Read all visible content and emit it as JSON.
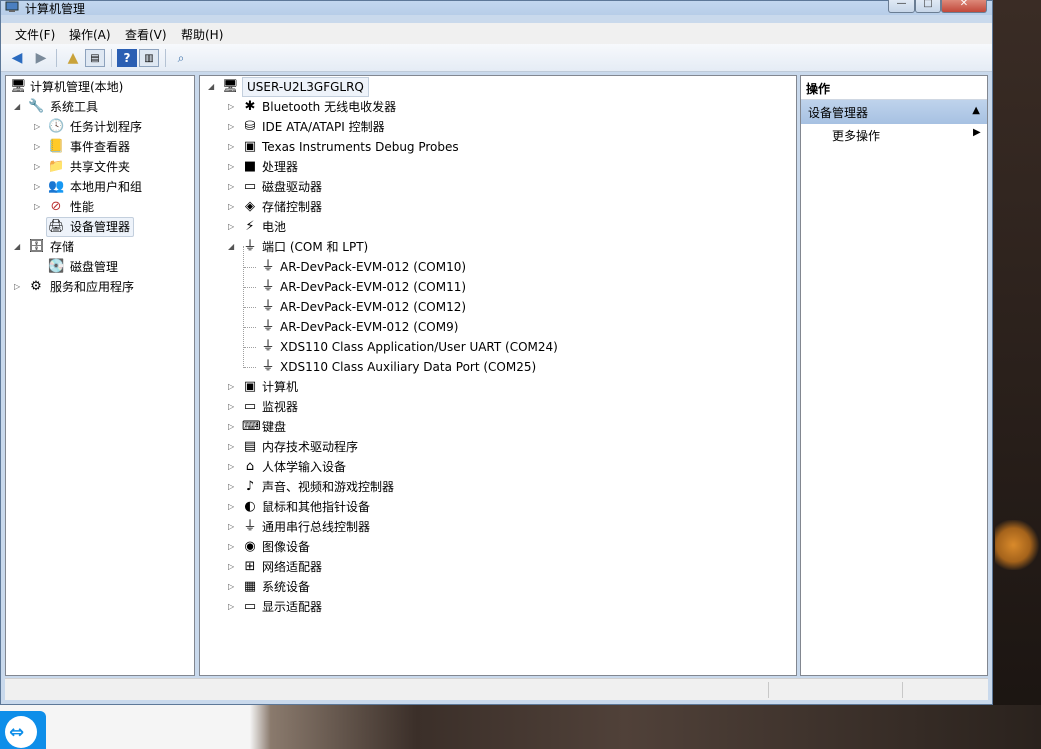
{
  "window": {
    "title": "计算机管理"
  },
  "menubar": {
    "items": [
      "文件(F)",
      "操作(A)",
      "查看(V)",
      "帮助(H)"
    ]
  },
  "left_tree": {
    "root": "计算机管理(本地)",
    "items": [
      {
        "label": "系统工具",
        "icon": "tools-icon"
      },
      {
        "label": "任务计划程序",
        "icon": "clock-icon"
      },
      {
        "label": "事件查看器",
        "icon": "event-viewer-icon"
      },
      {
        "label": "共享文件夹",
        "icon": "shared-folder-icon"
      },
      {
        "label": "本地用户和组",
        "icon": "users-icon"
      },
      {
        "label": "性能",
        "icon": "performance-icon"
      },
      {
        "label": "设备管理器",
        "icon": "device-manager-icon"
      },
      {
        "label": "存储",
        "icon": "storage-icon"
      },
      {
        "label": "磁盘管理",
        "icon": "disk-icon"
      },
      {
        "label": "服务和应用程序",
        "icon": "services-icon"
      }
    ]
  },
  "device_tree": {
    "root": "USER-U2L3GFGLRQ",
    "categories_top": [
      "Bluetooth 无线电收发器",
      "IDE ATA/ATAPI 控制器",
      "Texas Instruments Debug Probes",
      "处理器",
      "磁盘驱动器",
      "存储控制器",
      "电池",
      "端口 (COM 和 LPT)"
    ],
    "ports": [
      "AR-DevPack-EVM-012 (COM10)",
      "AR-DevPack-EVM-012 (COM11)",
      "AR-DevPack-EVM-012 (COM12)",
      "AR-DevPack-EVM-012 (COM9)",
      "XDS110 Class Application/User UART (COM24)",
      "XDS110 Class Auxiliary Data Port (COM25)"
    ],
    "categories_bottom": [
      "计算机",
      "监视器",
      "键盘",
      "内存技术驱动程序",
      "人体学输入设备",
      "声音、视频和游戏控制器",
      "鼠标和其他指针设备",
      "通用串行总线控制器",
      "图像设备",
      "网络适配器",
      "系统设备",
      "显示适配器"
    ]
  },
  "actions": {
    "header": "操作",
    "section": "设备管理器",
    "more": "更多操作"
  },
  "colors": {
    "selection": "#eef3fa",
    "actions_section": "#bfd3ec",
    "teamviewer": "#0e8ee9"
  }
}
